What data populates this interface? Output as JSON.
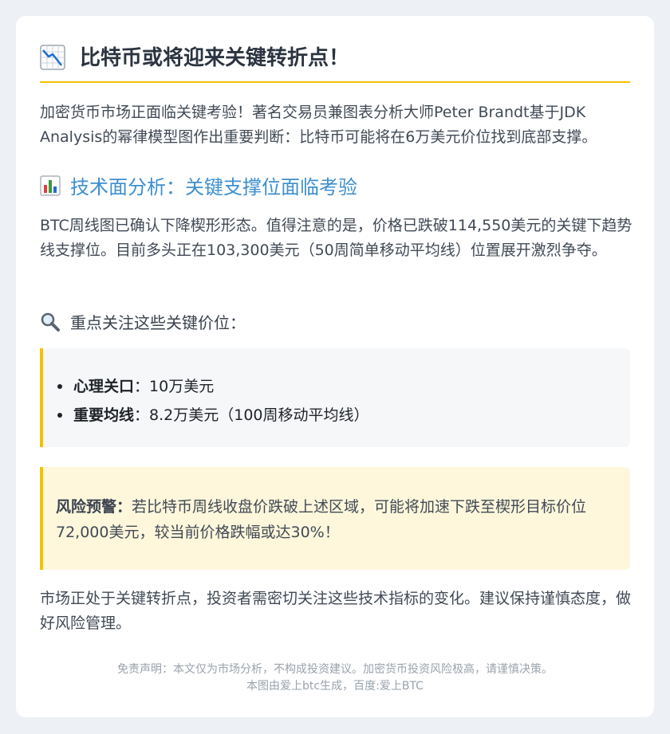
{
  "title": "比特币或将迎来关键转折点！",
  "intro": "加密货币市场正面临关键考验！著名交易员兼图表分析大师Peter Brandt基于JDK Analysis的幂律模型图作出重要判断：比特币可能将在6万美元价位找到底部支撑。",
  "section_technical": {
    "heading": "技术面分析：关键支撑位面临考验",
    "body": "BTC周线图已确认下降楔形形态。值得注意的是，价格已跌破114,550美元的关键下趋势线支撑位。目前多头正在103,300美元（50周简单移动平均线）位置展开激烈争夺。"
  },
  "section_levels": {
    "heading": "重点关注这些关键价位：",
    "items": [
      {
        "label": "心理关口",
        "sep": "：",
        "value": "10万美元"
      },
      {
        "label": "重要均线",
        "sep": "：",
        "value": "8.2万美元（100周移动平均线）"
      }
    ]
  },
  "warning": {
    "label": "风险预警：",
    "text": "若比特币周线收盘价跌破上述区域，可能将加速下跌至楔形目标价位72,000美元，较当前价格跌幅或达30%！"
  },
  "closing": "市场正处于关键转折点，投资者需密切关注这些技术指标的变化。建议保持谨慎态度，做好风险管理。",
  "footer": {
    "disclaimer": "免责声明：本文仅为市场分析，不构成投资建议。加密货币投资风险极高，请谨慎决策。",
    "credit": "本图由爱上btc生成，百度:爱上BTC"
  },
  "colors": {
    "accent": "#f2c200",
    "heading_blue": "#3d8fcf",
    "warning_bg": "#fef7dc",
    "chart_down_red": "#e0403a"
  },
  "icons": {
    "title": "chart-decreasing-icon",
    "technical": "bar-chart-icon",
    "levels": "magnifying-glass-icon"
  }
}
